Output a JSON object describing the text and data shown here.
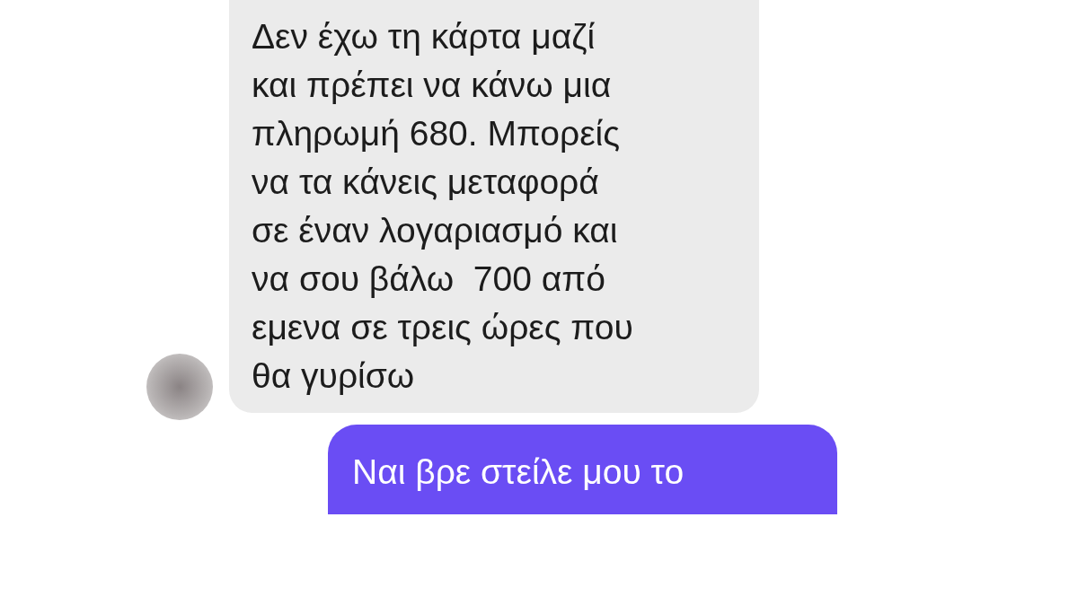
{
  "messages": [
    {
      "kind": "received",
      "text": "Δεν έχω τη κάρτα μαζί\nκαι πρέπει να κάνω μια\nπληρωμή 680. Μπορείς\nνα τα κάνεις μεταφορά\nσε έναν λογαριασμό και\nνα σου βάλω  700 από\nεμενα σε τρεις ώρες που\nθα γυρίσω"
    },
    {
      "kind": "sent",
      "text": "Ναι βρε στείλε μου το"
    }
  ]
}
